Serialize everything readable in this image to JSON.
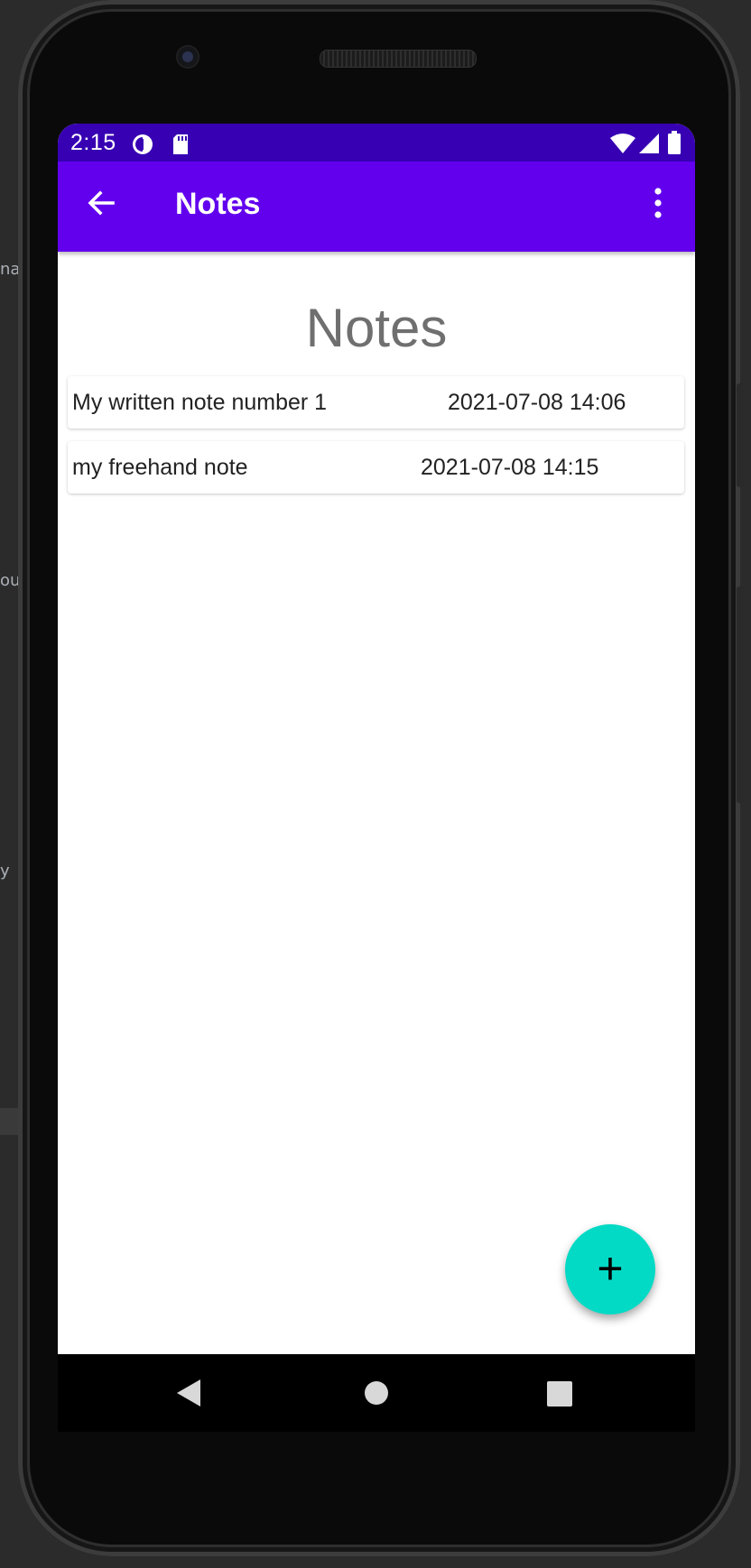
{
  "status_bar": {
    "time": "2:15",
    "icons": [
      "data-saver-icon",
      "sd-card-icon",
      "wifi-icon",
      "cell-signal-icon",
      "battery-icon"
    ]
  },
  "app_bar": {
    "title": "Notes",
    "back_icon": "arrow-back-icon",
    "menu_icon": "more-vert-icon"
  },
  "main": {
    "heading": "Notes",
    "notes": [
      {
        "title": "My written note number 1",
        "date": "2021-07-08 14:06"
      },
      {
        "title": "my freehand note",
        "date": "2021-07-08 14:15"
      }
    ]
  },
  "fab": {
    "label": "+",
    "icon": "add-icon"
  },
  "nav_bar": {
    "icons": [
      "back-triangle-icon",
      "home-circle-icon",
      "recents-square-icon"
    ]
  },
  "background_fragments": [
    "na",
    "ou",
    "y"
  ],
  "colors": {
    "status_bar": "#3700b3",
    "app_bar": "#6200ee",
    "fab": "#03dac5",
    "heading_text": "#6f6f6f"
  }
}
